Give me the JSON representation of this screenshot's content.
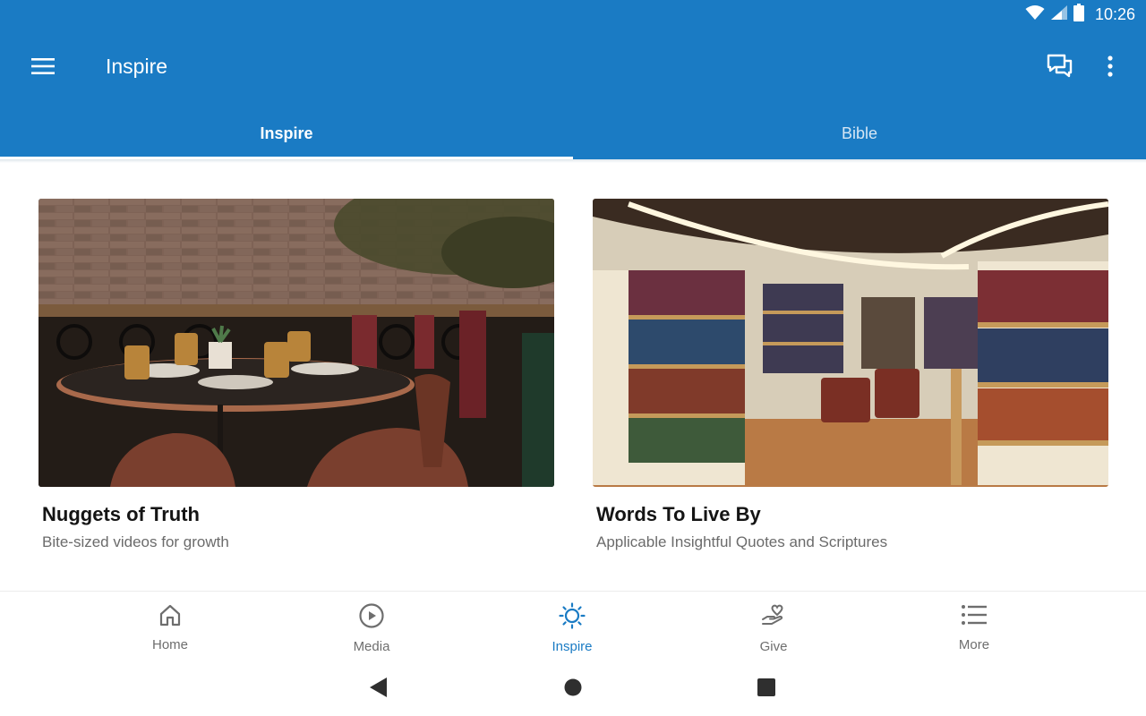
{
  "status_bar": {
    "time": "10:26",
    "wifi_icon": "wifi-icon",
    "signal_icon": "signal-icon",
    "battery_icon": "battery-icon"
  },
  "app_bar": {
    "title": "Inspire",
    "menu_icon": "menu-icon",
    "chat_icon": "chat-icon",
    "more_icon": "more-vert-icon",
    "background": "#1a7bc4"
  },
  "tabs": [
    {
      "label": "Inspire",
      "active": true
    },
    {
      "label": "Bible",
      "active": false
    }
  ],
  "cards": [
    {
      "title": "Nuggets of Truth",
      "subtitle": "Bite-sized videos for growth",
      "image": "restaurant-table-photo"
    },
    {
      "title": "Words To Live By",
      "subtitle": "Applicable Insightful Quotes and Scriptures",
      "image": "library-bookshelves-photo"
    }
  ],
  "bottom_nav": [
    {
      "label": "Home",
      "icon": "home-icon",
      "active": false
    },
    {
      "label": "Media",
      "icon": "play-circle-icon",
      "active": false
    },
    {
      "label": "Inspire",
      "icon": "sun-icon",
      "active": true
    },
    {
      "label": "Give",
      "icon": "give-hand-heart-icon",
      "active": false
    },
    {
      "label": "More",
      "icon": "list-icon",
      "active": false
    }
  ],
  "system_nav": {
    "back_icon": "back-icon",
    "home_icon": "home-circle-icon",
    "recents_icon": "recents-icon"
  },
  "colors": {
    "primary": "#1a7bc4",
    "inactive_nav": "#6e6e6e"
  }
}
